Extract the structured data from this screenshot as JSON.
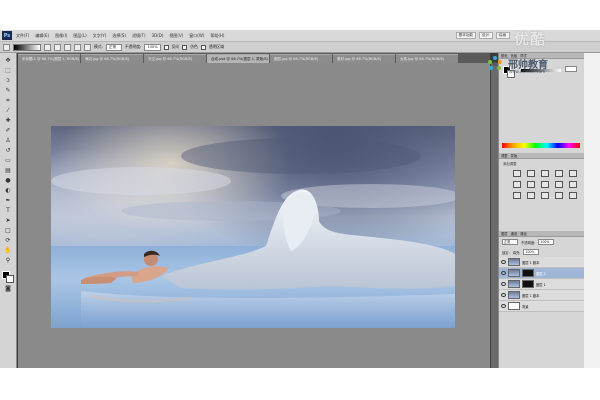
{
  "app": {
    "logo": "Ps",
    "menu": [
      "文件(F)",
      "编辑(E)",
      "图像(I)",
      "图层(L)",
      "文字(Y)",
      "选择(S)",
      "滤镜(T)",
      "3D(D)",
      "视图(V)",
      "窗口(W)",
      "帮助(H)"
    ],
    "menubar_right": [
      "基本功能",
      "设计",
      "绘画"
    ]
  },
  "options": {
    "mode_label": "模式:",
    "mode_value": "正常",
    "opacity_label": "不透明度:",
    "opacity_value": "100%",
    "reverse_label": "反向",
    "dither_label": "仿色",
    "transparency_label": "透明区域"
  },
  "tabs": [
    {
      "label": "未标题-1 @ 66.7%(图层 1, RGB/8)",
      "active": false
    },
    {
      "label": "海边.jpg @ 66.7%(RGB/8)",
      "active": false
    },
    {
      "label": "天空.jpg @ 66.7%(RGB/8)",
      "active": false
    },
    {
      "label": "合成.psd @ 66.7%(图层 1, 蒙版/8)",
      "active": true
    },
    {
      "label": "图层.jpg @ 66.7%(RGB/8)",
      "active": false
    },
    {
      "label": "素材.jpg @ 66.7%(RGB/8)",
      "active": false
    },
    {
      "label": "女孩.jpg @ 66.7%(RGB/8)",
      "active": false
    }
  ],
  "panels": {
    "color_tabs": [
      "颜色",
      "色板",
      "样式"
    ],
    "adjust_tabs": [
      "调整",
      "蒙版"
    ],
    "adjust_title": "添加调整",
    "layer_tabs": [
      "图层",
      "通道",
      "路径"
    ],
    "blend_mode": "正常",
    "opacity_label": "不透明度:",
    "opacity_value": "100%",
    "lock_label": "锁定:",
    "fill_label": "填充:",
    "fill_value": "100%"
  },
  "layers": [
    {
      "name": "图层 1 副本",
      "selected": false,
      "has_mask": false
    },
    {
      "name": "图层 2",
      "selected": true,
      "has_mask": true
    },
    {
      "name": "图层 1",
      "selected": false,
      "has_mask": true
    },
    {
      "name": "图层 1 副本",
      "selected": false,
      "has_mask": false
    },
    {
      "name": "背景",
      "selected": false,
      "has_mask": false
    }
  ],
  "watermark": {
    "top": "优酷",
    "brand": "邢帅教育",
    "sub": "www.xsteach.com"
  },
  "colors": {
    "accent": "#e8e000",
    "selection": "#9fb6d6"
  }
}
